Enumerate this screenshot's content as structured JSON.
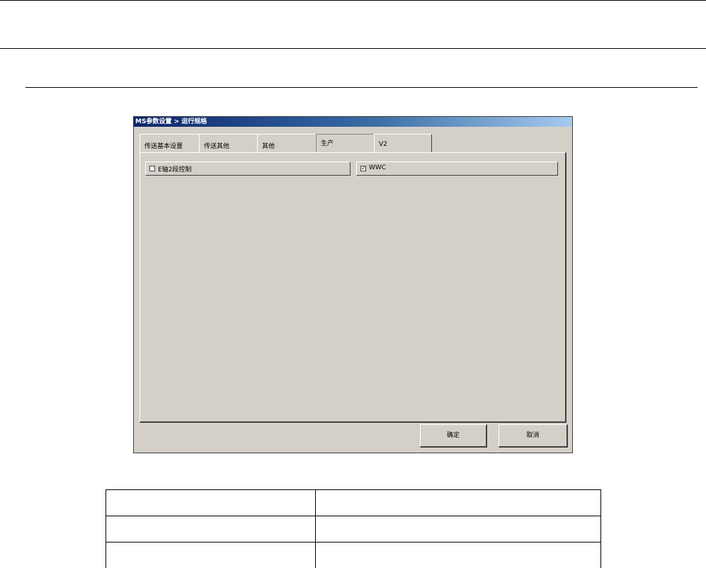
{
  "dialog": {
    "title": "MS参数设置 > 运行规格",
    "tabs": [
      {
        "label": "传送基本设置",
        "active": false
      },
      {
        "label": "传送其他",
        "active": false
      },
      {
        "label": "其他",
        "active": false
      },
      {
        "label": "生产",
        "active": true
      },
      {
        "label": "V2",
        "active": false
      }
    ],
    "options": [
      {
        "label": "E轴2段控制",
        "checked": false
      },
      {
        "label": "WWC",
        "checked": true
      }
    ],
    "buttons": {
      "ok": "确定",
      "cancel": "取消"
    },
    "colors": {
      "face": "#d4d0c8",
      "title_start": "#0a246a",
      "title_end": "#a6caf0"
    }
  },
  "table": {
    "rows": [
      [
        "",
        ""
      ],
      [
        "",
        ""
      ],
      [
        "",
        ""
      ]
    ]
  }
}
